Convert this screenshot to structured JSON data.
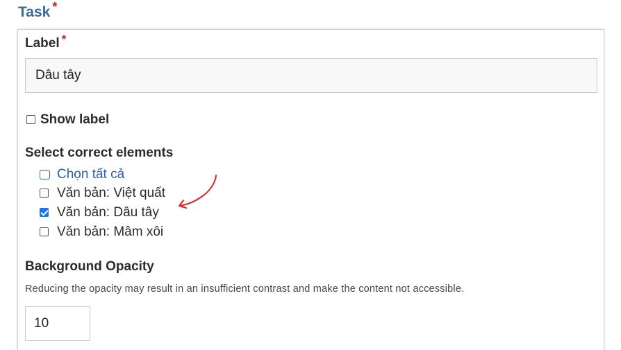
{
  "task": {
    "title": "Task",
    "required_mark": "*"
  },
  "label_field": {
    "label": "Label",
    "required_mark": "*",
    "value": "Dâu tây"
  },
  "show_label": {
    "label": "Show label",
    "checked": false
  },
  "select_correct": {
    "heading": "Select correct elements",
    "select_all_label": "Chọn tất cả",
    "options": [
      {
        "label": "Văn bản: Việt quất",
        "checked": false
      },
      {
        "label": "Văn bản: Dâu tây",
        "checked": true
      },
      {
        "label": "Văn bản: Mâm xôi",
        "checked": false
      }
    ]
  },
  "background_opacity": {
    "label": "Background Opacity",
    "description": "Reducing the opacity may result in an insufficient contrast and make the content not accessible.",
    "value": "10"
  },
  "colors": {
    "title": "#3d6999",
    "required": "#c51f1f",
    "link": "#2b5fb4",
    "checkbox_checked": "#1a73e8",
    "annotation_arrow": "#e0202a"
  }
}
